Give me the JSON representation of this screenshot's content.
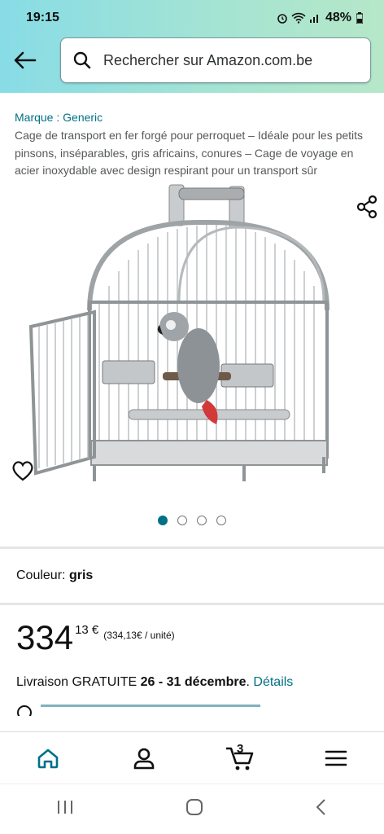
{
  "status": {
    "time": "19:15",
    "battery": "48%"
  },
  "search": {
    "placeholder": "Rechercher sur Amazon.com.be"
  },
  "product": {
    "brand": "Marque : Generic",
    "title": "Cage de transport en fer forgé pour perroquet – Idéale pour les petits pinsons, inséparables, gris africains, conures – Cage de voyage en acier inoxydable avec design respirant pour un transport sûr"
  },
  "gallery": {
    "dots": 4,
    "active": 0
  },
  "color": {
    "label": "Couleur:",
    "value": "gris"
  },
  "price": {
    "whole": "334",
    "fraction": "13 €",
    "per_unit": "(334,13€ / unité)"
  },
  "delivery": {
    "prefix": "Livraison GRATUITE",
    "dates": "26 - 31 décembre",
    "link": "Détails"
  },
  "nav": {
    "cart_count": "3"
  },
  "colors": {
    "accent": "#007185"
  }
}
